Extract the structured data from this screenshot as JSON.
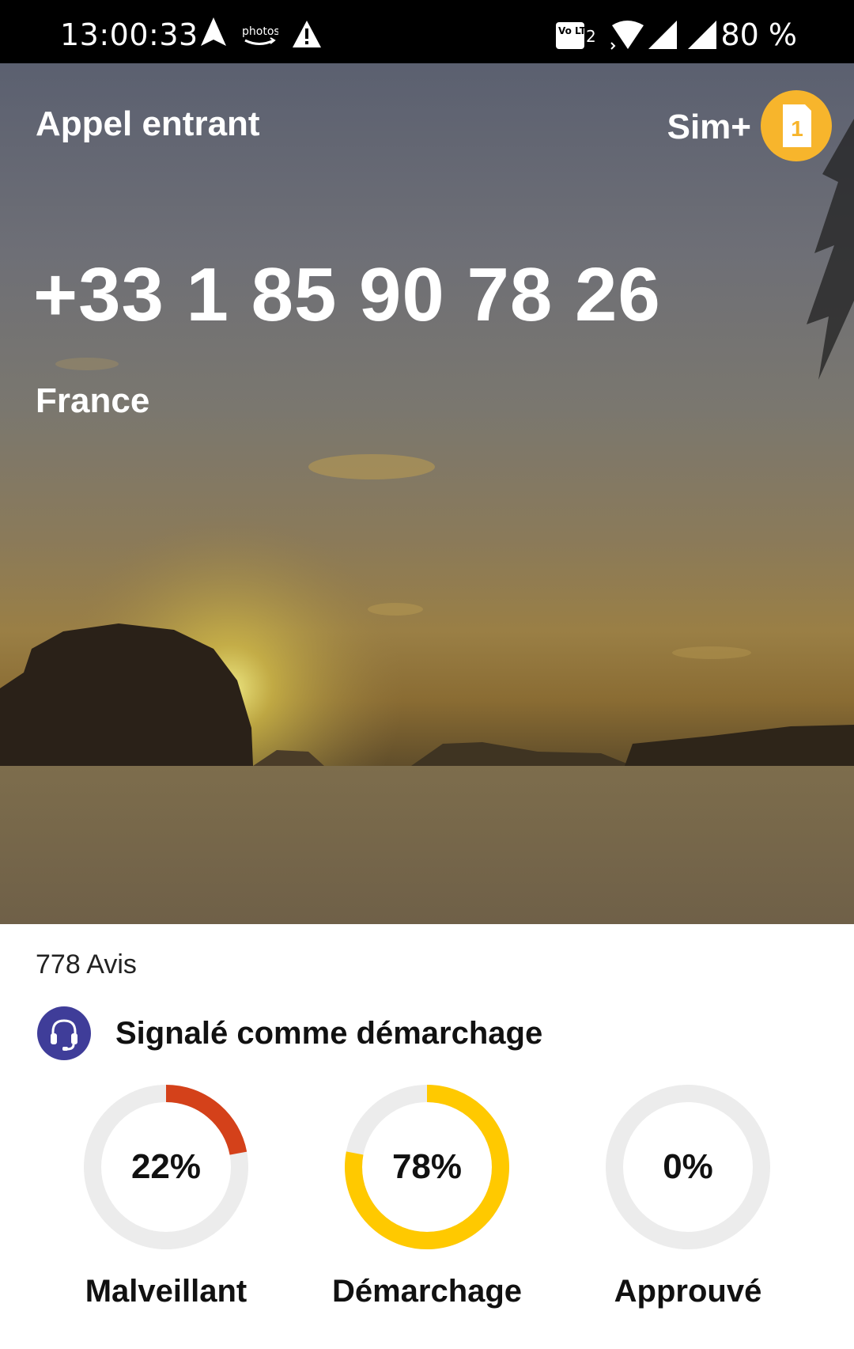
{
  "status_bar": {
    "time": "13:00:33",
    "icons": [
      "navigation-arrow-icon",
      "amazon-photos-icon",
      "warning-icon",
      "volte-2-icon",
      "wifi-icon",
      "signal-icon",
      "signal-icon"
    ],
    "amazon_photos_text": "photos",
    "volte_text": "Vo LTE",
    "volte_sim": "2",
    "battery": "80 %"
  },
  "call": {
    "status": "Appel entrant",
    "sim_label": "Sim+",
    "sim_number": "1",
    "phone_number": "+33 1 85 90 78 26",
    "country": "France"
  },
  "details": {
    "reviews": "778 Avis",
    "tag": "Signalé comme démarchage",
    "tag_icon": "headset-icon",
    "stats": [
      {
        "label": "Malveillant",
        "percent_text": "22%",
        "value": 22,
        "color": "#d4411a"
      },
      {
        "label": "Démarchage",
        "percent_text": "78%",
        "value": 78,
        "color": "#ffc900"
      },
      {
        "label": "Approuvé",
        "percent_text": "0%",
        "value": 0,
        "color": "#4caf50"
      }
    ]
  },
  "colors": {
    "sim_badge": "#f7b52c",
    "tag_icon_bg": "#3f3d99",
    "ring_track": "#ececec"
  }
}
